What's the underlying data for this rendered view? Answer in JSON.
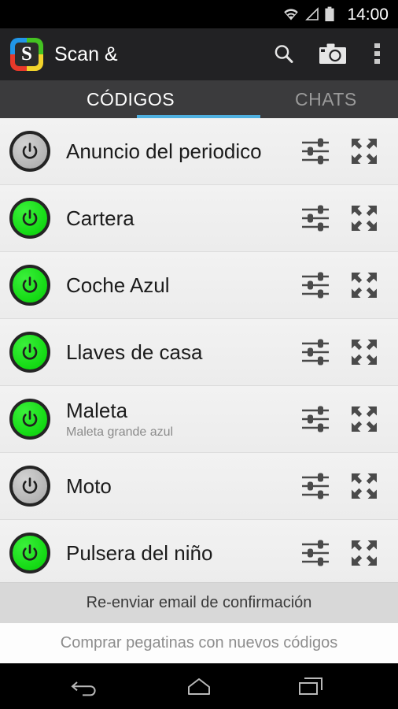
{
  "status_bar": {
    "time": "14:00",
    "icons": [
      "wifi-icon",
      "signal-icon",
      "battery-icon"
    ]
  },
  "action_bar": {
    "logo_letter": "S",
    "title": "Scan &",
    "buttons": [
      {
        "name": "search-button",
        "icon": "search-icon"
      },
      {
        "name": "camera-button",
        "icon": "camera-icon"
      },
      {
        "name": "overflow-button",
        "icon": "overflow-menu-icon"
      }
    ]
  },
  "tabs": {
    "active_index": 0,
    "underline_color": "#4fb0e0",
    "items": [
      {
        "label": "CÓDIGOS"
      },
      {
        "label": "CHATS"
      }
    ]
  },
  "list": {
    "row_icons": {
      "settings": "sliders-icon",
      "expand": "expand-arrows-icon"
    },
    "items": [
      {
        "title": "Anuncio del periodico",
        "subtitle": "",
        "state": "off"
      },
      {
        "title": "Cartera",
        "subtitle": "",
        "state": "on"
      },
      {
        "title": "Coche Azul",
        "subtitle": "",
        "state": "on"
      },
      {
        "title": "Llaves de casa",
        "subtitle": "",
        "state": "on"
      },
      {
        "title": "Maleta",
        "subtitle": "Maleta grande azul",
        "state": "on"
      },
      {
        "title": "Moto",
        "subtitle": "",
        "state": "off"
      },
      {
        "title": "Pulsera del niño",
        "subtitle": "",
        "state": "on"
      }
    ]
  },
  "footer": {
    "resend_label": "Re-enviar email de confirmación",
    "buy_label": "Comprar pegatinas con nuevos códigos"
  },
  "nav_bar": {
    "buttons": [
      {
        "name": "nav-back-button",
        "icon": "back-arrow-icon"
      },
      {
        "name": "nav-home-button",
        "icon": "home-icon"
      },
      {
        "name": "nav-recents-button",
        "icon": "recent-apps-icon"
      }
    ]
  },
  "colors": {
    "power_on": "#16db16",
    "power_off": "#b6b6b6",
    "accent": "#4fb0e0",
    "action_bar_bg": "#222224",
    "tab_bar_bg": "#3b3b3d"
  }
}
